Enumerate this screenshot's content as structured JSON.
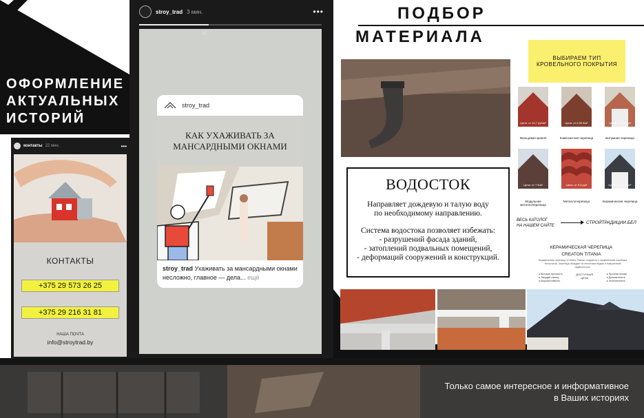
{
  "left": {
    "title": "ОФОРМЛЕНИЕ\nАКТУАЛЬНЫХ\nИСТОРИЙ",
    "story": {
      "username": "контакты",
      "time": "22 мин.",
      "more": "•••",
      "heading": "КОНТАКТЫ",
      "phone1": "+375 29 573 26 25",
      "phone2": "+375 29 216 31 81",
      "mail_label": "НАША ПОЧТА",
      "email": "info@stroytrad.by"
    },
    "close": "✕",
    "next": "›"
  },
  "center": {
    "username": "stroy_trad",
    "time": "3 мин.",
    "more": "•••",
    "progress": 0.38,
    "close": "✕",
    "card": {
      "username": "stroy_trad",
      "title": "КАК УХАЖИВАТЬ ЗА\nМАНСАРДНЫМИ ОКНАМИ",
      "caption_user": "stroy_trad",
      "caption_text": "Ухаживать за мансардными окнами несложно, главное — дела...",
      "caption_more": "ещё"
    }
  },
  "right": {
    "title1": "ПОДБОР",
    "title2": "МАТЕРИАЛА",
    "box": {
      "heading": "ВОДОСТОК",
      "text1": "Направляет дождевую и талую воду\nпо необходимому направлению.",
      "text2": "Система водостока позволяет избежать:\n- разрушений фасада зданий,\n- затоплений подвальных помещений,\n- деформаций сооружений и конструкций."
    },
    "yellow": "ВЫБИРАЕМ ТИП\nКРОВЕЛЬНОГО ПОКРЫТИЯ",
    "tiles": [
      {
        "label": "Фальцевая кровля",
        "price": "Цена: от 16,7 руб/м²"
      },
      {
        "label": "Композитная черепица",
        "price": "Цена: от 6,99 €/м²"
      },
      {
        "label": "Битумная черепица",
        "price": "Цена: от 8,58 руб"
      },
      {
        "label": "Модульная металлочерепица",
        "price": "Цена: от 7 €/м²"
      },
      {
        "label": "Металлочерепица",
        "price": "Цена: от 9,5 руб"
      },
      {
        "label": "Керамическая черепица",
        "price": "Цена: от 11,7 €/м²"
      }
    ],
    "catalog": "ВЕСЬ КАТОЛОГ\nНА НАШЕМ САЙТЕ",
    "site": "СТРОЙТРАДИЦИИ.БЕЛ",
    "ceramic_title": "КЕРАМИЧЕСКАЯ ЧЕРЕПИЦА",
    "ceramic_sub": "CREATON TITANIA",
    "ceramic_small": "Керамическая черепица «Creaton Titania» создается с применением новейших технологий. Черепица обладает эстетическим видом и повышенной надёжностью.",
    "ceramic_col1": "● Высокая прочность\n● Твердый глянец\n● Морозостойкость",
    "ceramic_col2": "ДОСТУПНАЯ\nЦЕНА",
    "ceramic_col3": "● Прочная основа\n● Долговечность\n● Экологичность"
  },
  "bottom": {
    "text": "Только самое интересное и информативное\nв Ваших историях"
  }
}
